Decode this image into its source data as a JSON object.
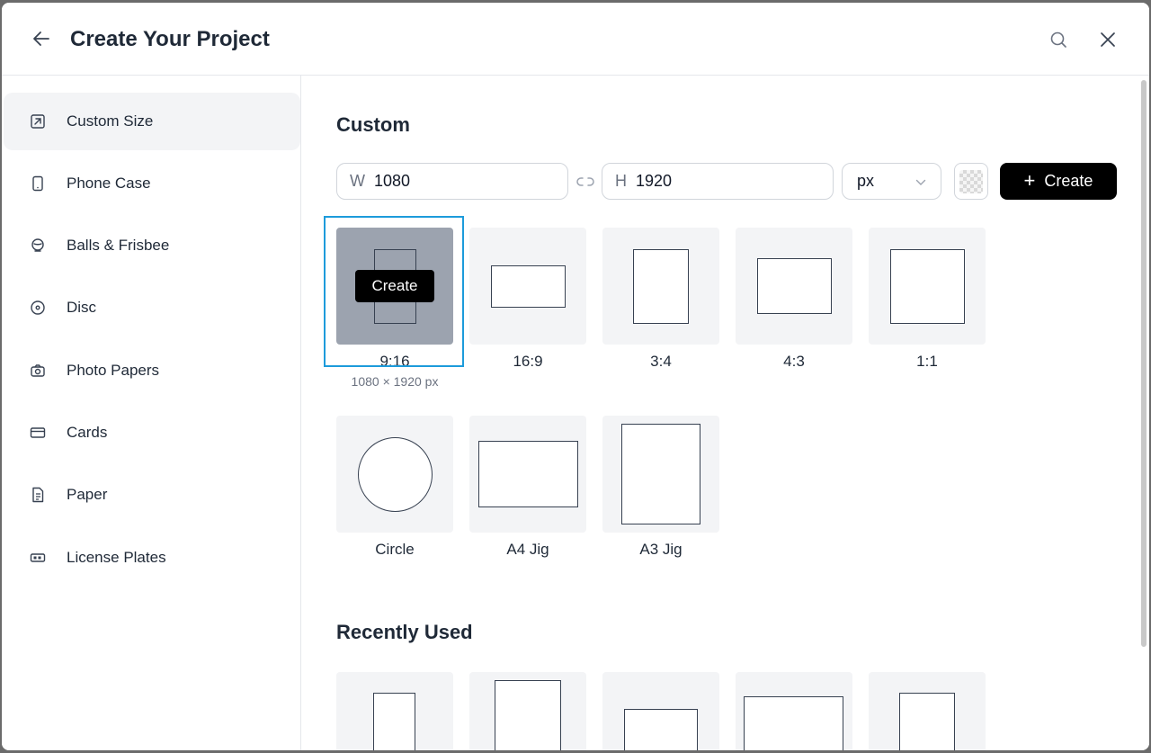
{
  "header": {
    "title": "Create Your Project"
  },
  "sidebar": {
    "items": [
      {
        "label": "Custom Size",
        "icon": "edit-resize-icon"
      },
      {
        "label": "Phone Case",
        "icon": "phone-icon"
      },
      {
        "label": "Balls & Frisbee",
        "icon": "ball-icon"
      },
      {
        "label": "Disc",
        "icon": "disc-icon"
      },
      {
        "label": "Photo Papers",
        "icon": "camera-icon"
      },
      {
        "label": "Cards",
        "icon": "card-icon"
      },
      {
        "label": "Paper",
        "icon": "document-icon"
      },
      {
        "label": "License Plates",
        "icon": "license-plate-icon"
      }
    ],
    "active_index": 0
  },
  "custom": {
    "title": "Custom",
    "width_prefix": "W",
    "width_value": "1080",
    "height_prefix": "H",
    "height_value": "1920",
    "unit": "px",
    "create_label": "Create"
  },
  "presets": [
    {
      "label": "9:16",
      "sub": "1080 × 1920 px",
      "hover_label": "Create",
      "selected": true
    },
    {
      "label": "16:9"
    },
    {
      "label": "3:4"
    },
    {
      "label": "4:3"
    },
    {
      "label": "1:1"
    },
    {
      "label": "Circle"
    },
    {
      "label": "A4 Jig"
    },
    {
      "label": "A3 Jig"
    }
  ],
  "recent": {
    "title": "Recently Used"
  },
  "colors": {
    "accent": "#1d9bdb",
    "primary_button": "#000000",
    "tile_bg": "#f3f4f6",
    "active_sidebar_bg": "#f3f4f6"
  }
}
